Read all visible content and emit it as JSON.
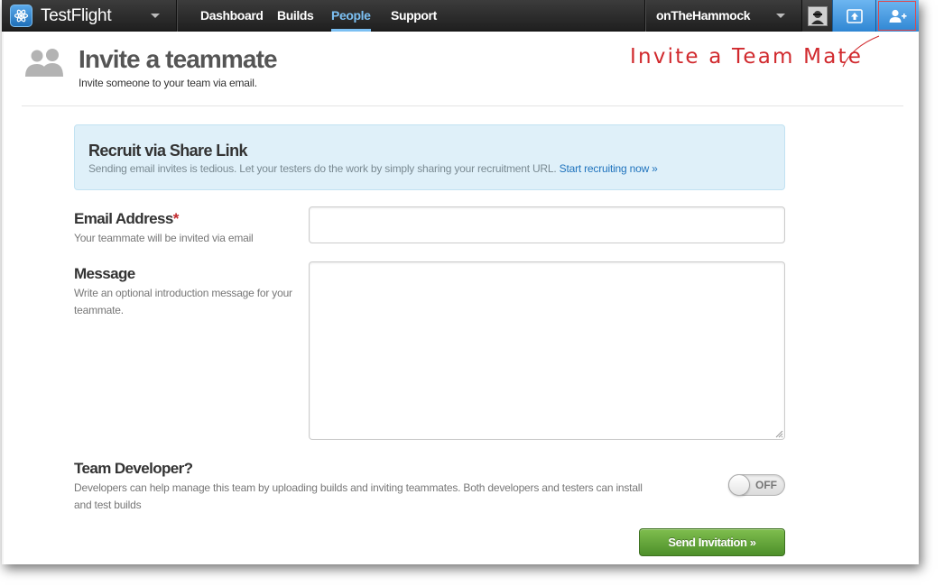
{
  "topbar": {
    "brand_name": "TestFlight",
    "nav": [
      {
        "label": "Dashboard",
        "active": false
      },
      {
        "label": "Builds",
        "active": false
      },
      {
        "label": "People",
        "active": true
      },
      {
        "label": "Support",
        "active": false
      }
    ],
    "account_name": "onTheHammock",
    "icons": {
      "logo": "testflight-logo-icon",
      "brand_menu": "chevron-down-icon",
      "account_menu": "chevron-down-icon",
      "avatar": "user-avatar",
      "upload": "upload-icon",
      "invite": "add-user-icon"
    }
  },
  "page": {
    "title": "Invite a teammate",
    "subtitle": "Invite someone to your team via email.",
    "icon": "people-icon"
  },
  "annotation": {
    "text": "Invite a Team Mate",
    "color": "#d12a2e"
  },
  "share_banner": {
    "title": "Recruit via Share Link",
    "text": "Sending email invites is tedious. Let your testers do the work by simply sharing your recruitment URL.",
    "link_label": "Start recruiting now »"
  },
  "form": {
    "email": {
      "label": "Email Address",
      "required_mark": "*",
      "help": "Your teammate will be invited via email",
      "value": "",
      "placeholder": ""
    },
    "message": {
      "label": "Message",
      "help": "Write an optional introduction message for your teammate.",
      "value": "",
      "placeholder": ""
    },
    "team_developer": {
      "label": "Team Developer?",
      "help": "Developers can help manage this team by uploading builds and inviting teammates. Both developers and testers can install and test builds",
      "toggle_label": "OFF",
      "enabled": false
    },
    "submit_label": "Send Invitation »"
  },
  "colors": {
    "accent": "#7cc0f3",
    "link": "#1f73bd",
    "banner_bg": "#dff0f9",
    "button_green": "#5fa234",
    "required": "#c0282c"
  }
}
